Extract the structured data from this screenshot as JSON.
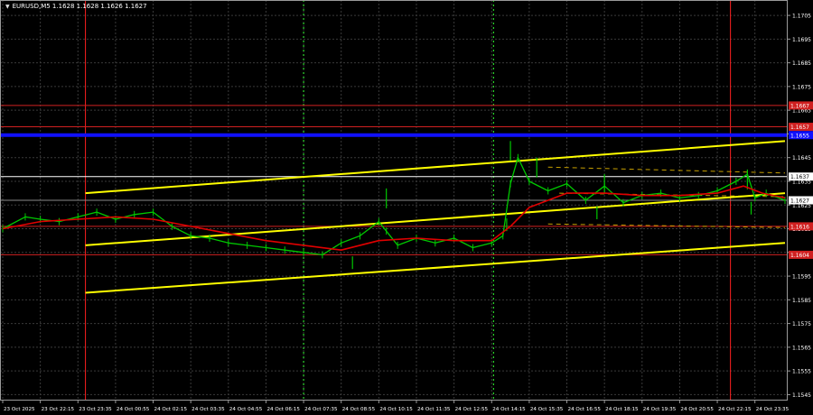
{
  "window": {
    "title": "EURUSD,M5  1.1628 1.1628 1.1626 1.1627"
  },
  "colors": {
    "background": "#000000",
    "grid": "#3a3a3a",
    "candle": "#00c800",
    "moving_average": "#e00000",
    "channel": "#ffff00",
    "blue_level": "#1010ff",
    "red_level": "#d02020",
    "white_level": "#ffffff",
    "session_line": "#ff2020",
    "time_line": "#30ff30",
    "axis_text": "#ffffff"
  },
  "chart_data": {
    "type": "line",
    "symbol": "EURUSD",
    "timeframe": "M5",
    "title": "EURUSD,M5  1.1628 1.1628 1.1626 1.1627",
    "xlabel": "",
    "ylabel": "",
    "ylim": [
      1.15425,
      1.17115
    ],
    "yticks": [
      1.1705,
      1.1695,
      1.1685,
      1.1675,
      1.1665,
      1.1655,
      1.1645,
      1.1635,
      1.1625,
      1.1615,
      1.1605,
      1.1595,
      1.1585,
      1.1575,
      1.1565,
      1.1555,
      1.1545
    ],
    "xticks": [
      "23 Oct 2025",
      "23 Oct 22:15",
      "23 Oct 23:35",
      "24 Oct 00:55",
      "24 Oct 02:15",
      "24 Oct 03:35",
      "24 Oct 04:55",
      "24 Oct 06:15",
      "24 Oct 07:35",
      "24 Oct 08:55",
      "24 Oct 10:15",
      "24 Oct 11:35",
      "24 Oct 12:55",
      "24 Oct 14:15",
      "24 Oct 15:35",
      "24 Oct 16:55",
      "24 Oct 18:15",
      "24 Oct 19:35",
      "24 Oct 20:55",
      "24 Oct 22:15",
      "24 Oct 23:35"
    ],
    "x_range": [
      0,
      20.8
    ],
    "price_series": {
      "name": "",
      "x": [
        0.0,
        0.6,
        1.0,
        1.5,
        2.0,
        2.5,
        3.0,
        3.5,
        4.0,
        4.5,
        5.0,
        5.5,
        6.0,
        6.5,
        7.0,
        7.5,
        8.0,
        8.5,
        9.0,
        9.5,
        10.0,
        10.2,
        10.5,
        11.0,
        11.5,
        12.0,
        12.5,
        13.0,
        13.3,
        13.5,
        13.7,
        14.0,
        14.5,
        15.0,
        15.5,
        16.0,
        16.5,
        17.0,
        17.5,
        18.0,
        18.5,
        19.0,
        19.5,
        19.8,
        20.0,
        20.3,
        20.8
      ],
      "y": [
        1.1615,
        1.162,
        1.1619,
        1.1618,
        1.162,
        1.1622,
        1.1619,
        1.1621,
        1.1622,
        1.1616,
        1.1612,
        1.1611,
        1.1609,
        1.1608,
        1.1607,
        1.1606,
        1.1605,
        1.1604,
        1.1609,
        1.1612,
        1.1618,
        1.1614,
        1.1608,
        1.1611,
        1.1609,
        1.1611,
        1.1607,
        1.1609,
        1.1612,
        1.1634,
        1.1645,
        1.1635,
        1.1631,
        1.1634,
        1.1627,
        1.1633,
        1.1626,
        1.1629,
        1.163,
        1.1628,
        1.1629,
        1.1631,
        1.1635,
        1.1638,
        1.1628,
        1.163,
        1.1627
      ],
      "highs": [
        [
          10.2,
          1.1632
        ],
        [
          13.5,
          1.1652
        ],
        [
          14.2,
          1.1645
        ],
        [
          16.0,
          1.1638
        ],
        [
          19.8,
          1.164
        ]
      ],
      "lows": [
        [
          9.3,
          1.1598
        ],
        [
          13.4,
          1.1614
        ],
        [
          15.8,
          1.1619
        ],
        [
          19.9,
          1.1621
        ]
      ]
    },
    "moving_average": {
      "name": "",
      "x": [
        0.0,
        1.0,
        2.0,
        3.0,
        4.0,
        5.0,
        6.0,
        7.0,
        8.0,
        9.0,
        10.0,
        11.0,
        12.0,
        13.0,
        13.5,
        14.0,
        15.0,
        16.0,
        17.0,
        18.0,
        19.0,
        19.7,
        20.2,
        20.8
      ],
      "y": [
        1.1615,
        1.1618,
        1.1619,
        1.162,
        1.1619,
        1.1616,
        1.1613,
        1.161,
        1.1608,
        1.1606,
        1.161,
        1.1611,
        1.161,
        1.161,
        1.1616,
        1.1624,
        1.163,
        1.163,
        1.1629,
        1.1629,
        1.163,
        1.1633,
        1.163,
        1.1628
      ]
    },
    "horizontal_levels": [
      {
        "price": 1.1667,
        "color": "#d02020",
        "label": "1.1667"
      },
      {
        "price": 1.1658,
        "color": "#d02020",
        "label": "1.1657"
      },
      {
        "price": 1.16545,
        "color": "#1010ff",
        "label": "1.1655"
      },
      {
        "price": 1.1637,
        "color": "#ffffff",
        "label": "1.1637"
      },
      {
        "price": 1.1616,
        "color": "#d02020",
        "label": "1.1616"
      },
      {
        "price": 1.1604,
        "color": "#d02020",
        "label": "1.1604"
      }
    ],
    "current_price": {
      "price": 1.1627,
      "label": "1.1627"
    },
    "dashed_levels": [
      {
        "price_start": 1.1641,
        "price_end": 1.16385,
        "x_start": 14.5,
        "x_end": 20.8,
        "color": "#c8a000"
      },
      {
        "price_start": 1.1617,
        "price_end": 1.16155,
        "x_start": 14.5,
        "x_end": 20.8,
        "color": "#c8a000"
      },
      {
        "price_start": 1.163,
        "price_end": 1.16285,
        "x_start": 14.8,
        "x_end": 20.8,
        "color": "#c8a000"
      }
    ],
    "channel_lines": [
      {
        "x": [
          2.2,
          20.8
        ],
        "y": [
          1.163,
          1.1652
        ]
      },
      {
        "x": [
          2.2,
          20.8
        ],
        "y": [
          1.1608,
          1.163
        ]
      },
      {
        "x": [
          2.2,
          20.8
        ],
        "y": [
          1.1588,
          1.1609
        ]
      }
    ],
    "vertical_lines": [
      {
        "x": 2.2,
        "color": "#ff2020",
        "style": "solid"
      },
      {
        "x": 19.35,
        "color": "#ff2020",
        "style": "solid"
      },
      {
        "x": 8.0,
        "color": "#30ff30",
        "style": "dotted"
      },
      {
        "x": 13.05,
        "color": "#30ff30",
        "style": "dotted"
      }
    ],
    "grid": true,
    "legend": "none"
  }
}
